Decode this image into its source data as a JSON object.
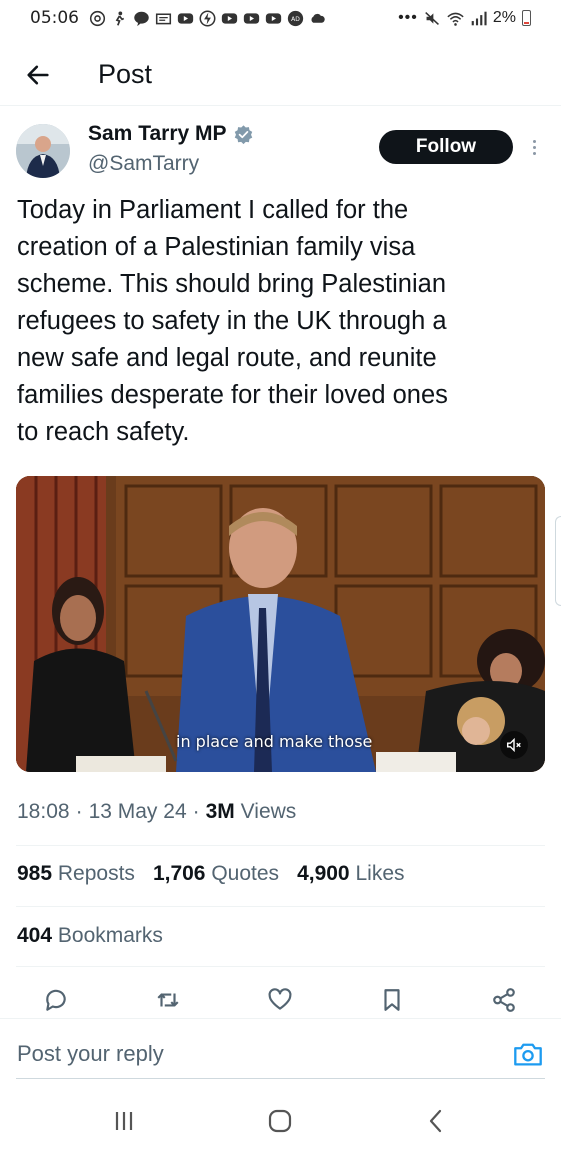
{
  "status_bar": {
    "time": "05:06",
    "battery": "2%",
    "icons": [
      "at-sign-icon",
      "person-walking-icon",
      "line-chat-icon",
      "news-icon",
      "youtube-icon",
      "lightning-icon",
      "youtube-icon",
      "youtube-icon",
      "youtube-icon",
      "ad-icon",
      "cloud-icon",
      "more-dots-icon",
      "mute-icon",
      "wifi-icon",
      "signal-icon",
      "battery-icon"
    ]
  },
  "header": {
    "title": "Post"
  },
  "author": {
    "name": "Sam Tarry MP",
    "handle": "@SamTarry",
    "follow_label": "Follow",
    "verified_color": "#829aab"
  },
  "tweet": {
    "lines": [
      "Today in Parliament I called for the",
      "creation of a Palestinian family visa",
      "scheme. This should bring Palestinian",
      "refugees to safety in the UK through a",
      "new safe and legal route, and reunite",
      "families desperate for their loved ones",
      "to reach safety."
    ]
  },
  "media": {
    "caption": "in place and make those"
  },
  "meta": {
    "time": "18:08",
    "date": "13 May 24",
    "views_count": "3M",
    "views_label": "Views"
  },
  "stats": {
    "reposts_count": "985",
    "reposts_label": "Reposts",
    "quotes_count": "1,706",
    "quotes_label": "Quotes",
    "likes_count": "4,900",
    "likes_label": "Likes",
    "bookmarks_count": "404",
    "bookmarks_label": "Bookmarks"
  },
  "reply": {
    "placeholder": "Post your reply"
  },
  "colors": {
    "accent": "#1d9bf0",
    "text": "#0f1419",
    "secondary": "#536471"
  }
}
